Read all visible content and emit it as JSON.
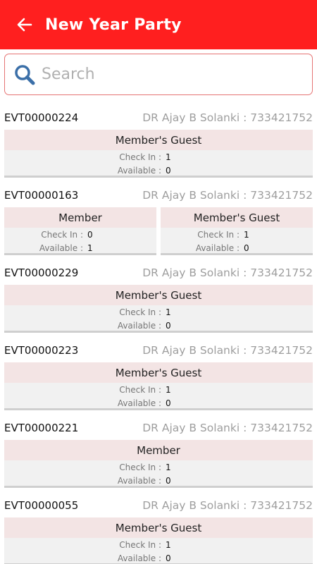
{
  "header": {
    "title": "New Year Party"
  },
  "search": {
    "placeholder": "Search"
  },
  "labels": {
    "check_in": "Check In :",
    "available": "Available :"
  },
  "events": [
    {
      "id": "EVT00000224",
      "owner": "DR Ajay B Solanki : 733421752",
      "cards": [
        {
          "type": "Member's Guest",
          "check_in": "1",
          "available": "0"
        }
      ]
    },
    {
      "id": "EVT00000163",
      "owner": "DR Ajay B Solanki : 733421752",
      "cards": [
        {
          "type": "Member",
          "check_in": "0",
          "available": "1"
        },
        {
          "type": "Member's Guest",
          "check_in": "1",
          "available": "0"
        }
      ]
    },
    {
      "id": "EVT00000229",
      "owner": "DR Ajay B Solanki : 733421752",
      "cards": [
        {
          "type": "Member's Guest",
          "check_in": "1",
          "available": "0"
        }
      ]
    },
    {
      "id": "EVT00000223",
      "owner": "DR Ajay B Solanki : 733421752",
      "cards": [
        {
          "type": "Member's Guest",
          "check_in": "1",
          "available": "0"
        }
      ]
    },
    {
      "id": "EVT00000221",
      "owner": "DR Ajay B Solanki : 733421752",
      "cards": [
        {
          "type": "Member",
          "check_in": "1",
          "available": "0"
        }
      ]
    },
    {
      "id": "EVT00000055",
      "owner": "DR Ajay B Solanki : 733421752",
      "cards": [
        {
          "type": "Member's Guest",
          "check_in": "1",
          "available": "0"
        }
      ]
    }
  ],
  "colors": {
    "appbar": "#ff1f1f",
    "card_header": "#f3e4e4",
    "owner_text": "#9e9e9e"
  }
}
